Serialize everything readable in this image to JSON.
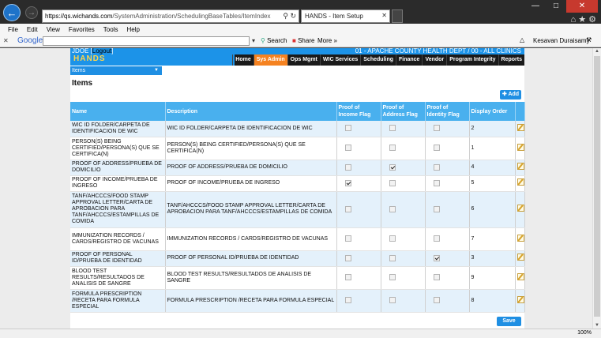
{
  "browser": {
    "url_host": "https://qs.wichands.com",
    "url_path": "/SystemAdministration/SchedulingBaseTables/ItemIndex",
    "tab_title": "HANDS - Item Setup",
    "menu": [
      "File",
      "Edit",
      "View",
      "Favorites",
      "Tools",
      "Help"
    ],
    "google_label": "Google",
    "search_label": "Search",
    "share_label": "Share",
    "more_label": "More »",
    "user_name": "Kesavan Duraisamy",
    "zoom": "100%"
  },
  "app": {
    "user_prefix": "JDOE [",
    "user_link": "Logout",
    "user_suffix": "]",
    "org": "01 - APACHE COUNTY HEALTH DEPT / 00 - ALL CLINICS",
    "logo": "HANDS",
    "nav": [
      "Home",
      "Sys Admin",
      "Ops Mgmt",
      "WIC Services",
      "Scheduling",
      "Finance",
      "Vendor",
      "Program Integrity",
      "Reports"
    ],
    "active_nav": "Sys Admin",
    "submenu_selected": "Items",
    "page_title": "Items",
    "add_label": "Add",
    "save_label": "Save"
  },
  "table": {
    "headers": [
      "Name",
      "Description",
      "Proof of Income Flag",
      "Proof of Address Flag",
      "Proof of Identity Flag",
      "Display Order"
    ],
    "rows": [
      {
        "name": "WIC ID FOLDER/CARPETA DE IDENTIFICACION DE WIC",
        "description": "WIC ID FOLDER/CARPETA DE IDENTIFICACION DE WIC",
        "income": false,
        "address": false,
        "identity": false,
        "order": "2"
      },
      {
        "name": "PERSON(S) BEING CERTIFIED/PERSONA(S) QUE SE CERTIFICA(N)",
        "description": "PERSON(S) BEING CERTIFIED/PERSONA(S) QUE SE CERTIFICA(N)",
        "income": false,
        "address": false,
        "identity": false,
        "order": "1"
      },
      {
        "name": "PROOF OF ADDRESS/PRUEBA DE DOMICILIO",
        "description": "PROOF OF ADDRESS/PRUEBA DE DOMICILIO",
        "income": false,
        "address": true,
        "identity": false,
        "order": "4"
      },
      {
        "name": "PROOF OF INCOME/PRUEBA DE INGRESO",
        "description": "PROOF OF INCOME/PRUEBA DE INGRESO",
        "income": true,
        "address": false,
        "identity": false,
        "order": "5"
      },
      {
        "name": "TANF/AHCCCS/FOOD STAMP APPROVAL LETTER/CARTA DE APROBACION PARA TANF/AHCCCS/ESTAMPILLAS DE COMIDA",
        "description": "TANF/AHCCCS/FOOD STAMP APPROVAL LETTER/CARTA DE APROBACION PARA TANF/AHCCCS/ESTAMPILLAS DE COMIDA",
        "income": false,
        "address": false,
        "identity": false,
        "order": "6"
      },
      {
        "name": "IMMUNIZATION RECORDS / CARDS/REGISTRO DE VACUNAS",
        "description": "IMMUNIZATION RECORDS / CARDS/REGISTRO DE VACUNAS",
        "income": false,
        "address": false,
        "identity": false,
        "order": "7"
      },
      {
        "name": "PROOF OF PERSONAL ID/PRUEBA DE IDENTIDAD",
        "description": "PROOF OF PERSONAL ID/PRUEBA DE IDENTIDAD",
        "income": false,
        "address": false,
        "identity": true,
        "order": "3"
      },
      {
        "name": "BLOOD TEST RESULTS/RESULTADOS DE ANALISIS DE SANGRE",
        "description": "BLOOD TEST RESULTS/RESULTADOS DE ANALISIS DE SANGRE",
        "income": false,
        "address": false,
        "identity": false,
        "order": "9"
      },
      {
        "name": "FORMULA PRESCRIPTION /RECETA PARA FORMULA ESPECIAL",
        "description": "FORMULA PRESCRIPTION /RECETA PARA FORMULA ESPECIAL",
        "income": false,
        "address": false,
        "identity": false,
        "order": "8"
      }
    ]
  },
  "colors": {
    "accent": "#1f8fe3",
    "header": "#49b0ee",
    "active_nav": "#f58220"
  }
}
